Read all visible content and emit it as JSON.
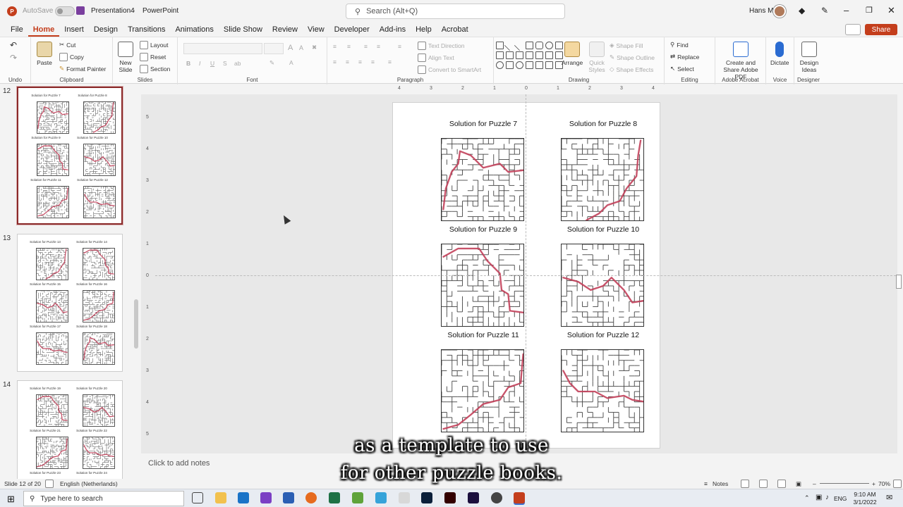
{
  "titlebar": {
    "autosave_label": "AutoSave",
    "autosave_state": "Off",
    "document_name": "Presentation4",
    "app_name": "PowerPoint",
    "search_placeholder": "Search (Alt+Q)",
    "user_name": "Hans M"
  },
  "menu": {
    "tabs": [
      "File",
      "Home",
      "Insert",
      "Design",
      "Transitions",
      "Animations",
      "Slide Show",
      "Review",
      "View",
      "Developer",
      "Add-ins",
      "Help",
      "Acrobat"
    ],
    "active": "Home",
    "share_label": "Share"
  },
  "ribbon": {
    "undo": {
      "label": "Undo"
    },
    "clipboard": {
      "label": "Clipboard",
      "paste": "Paste",
      "cut": "Cut",
      "copy": "Copy",
      "format_painter": "Format Painter"
    },
    "slides": {
      "label": "Slides",
      "new_slide": "New Slide",
      "layout": "Layout",
      "reset": "Reset",
      "section": "Section"
    },
    "font": {
      "label": "Font",
      "bold": "B",
      "italic": "I",
      "underline": "U",
      "strike": "S",
      "shadow": "ab",
      "grow": "A",
      "shrink": "A"
    },
    "paragraph": {
      "label": "Paragraph",
      "text_direction": "Text Direction",
      "align_text": "Align Text",
      "convert_smartart": "Convert to SmartArt"
    },
    "drawing": {
      "label": "Drawing",
      "arrange": "Arrange",
      "quick_styles": "Quick Styles",
      "shape_fill": "Shape Fill",
      "shape_outline": "Shape Outline",
      "shape_effects": "Shape Effects"
    },
    "editing": {
      "label": "Editing",
      "find": "Find",
      "replace": "Replace",
      "select": "Select"
    },
    "acrobat": {
      "label": "Adobe Acrobat",
      "create_share": "Create and Share Adobe PDF"
    },
    "voice": {
      "label": "Voice",
      "dictate": "Dictate"
    },
    "designer": {
      "label": "Designer",
      "design_ideas": "Design Ideas"
    }
  },
  "thumbnails": [
    {
      "number": "12",
      "selected": true,
      "labels": [
        "Solution for Puzzle 7",
        "Solution for Puzzle 8",
        "Solution for Puzzle 9",
        "Solution for Puzzle 10",
        "Solution for Puzzle 11",
        "Solution for Puzzle 12"
      ]
    },
    {
      "number": "13",
      "selected": false,
      "labels": [
        "Solution for Puzzle 13",
        "Solution for Puzzle 14",
        "Solution for Puzzle 15",
        "Solution for Puzzle 16",
        "Solution for Puzzle 17",
        "Solution for Puzzle 18"
      ]
    },
    {
      "number": "14",
      "selected": false,
      "labels": [
        "Solution for Puzzle 19",
        "Solution for Puzzle 20",
        "Solution for Puzzle 21",
        "Solution for Puzzle 22",
        "Solution for Puzzle 23",
        "Solution for Puzzle 24"
      ]
    }
  ],
  "slide": {
    "puzzles": [
      "Solution for Puzzle 7",
      "Solution for Puzzle 8",
      "Solution for Puzzle 9",
      "Solution for Puzzle 10",
      "Solution for Puzzle 11",
      "Solution for Puzzle 12"
    ]
  },
  "ruler_h": [
    "4",
    "3",
    "2",
    "1",
    "0",
    "1",
    "2",
    "3",
    "4"
  ],
  "ruler_v": [
    "5",
    "4",
    "3",
    "2",
    "1",
    "0",
    "1",
    "2",
    "3",
    "4",
    "5"
  ],
  "notes_placeholder": "Click to add notes",
  "status": {
    "slide_info": "Slide 12 of 20",
    "language": "English (Netherlands)",
    "notes": "Notes",
    "zoom": "70%"
  },
  "taskbar": {
    "search_placeholder": "Type here to search",
    "lang": "ENG",
    "time": "9:10 AM",
    "date": "3/1/2022"
  },
  "caption": {
    "line1": "as a template to use",
    "line2": "for other puzzle books."
  },
  "colors": {
    "accent": "#c43e1c",
    "path": "#c2405a"
  }
}
